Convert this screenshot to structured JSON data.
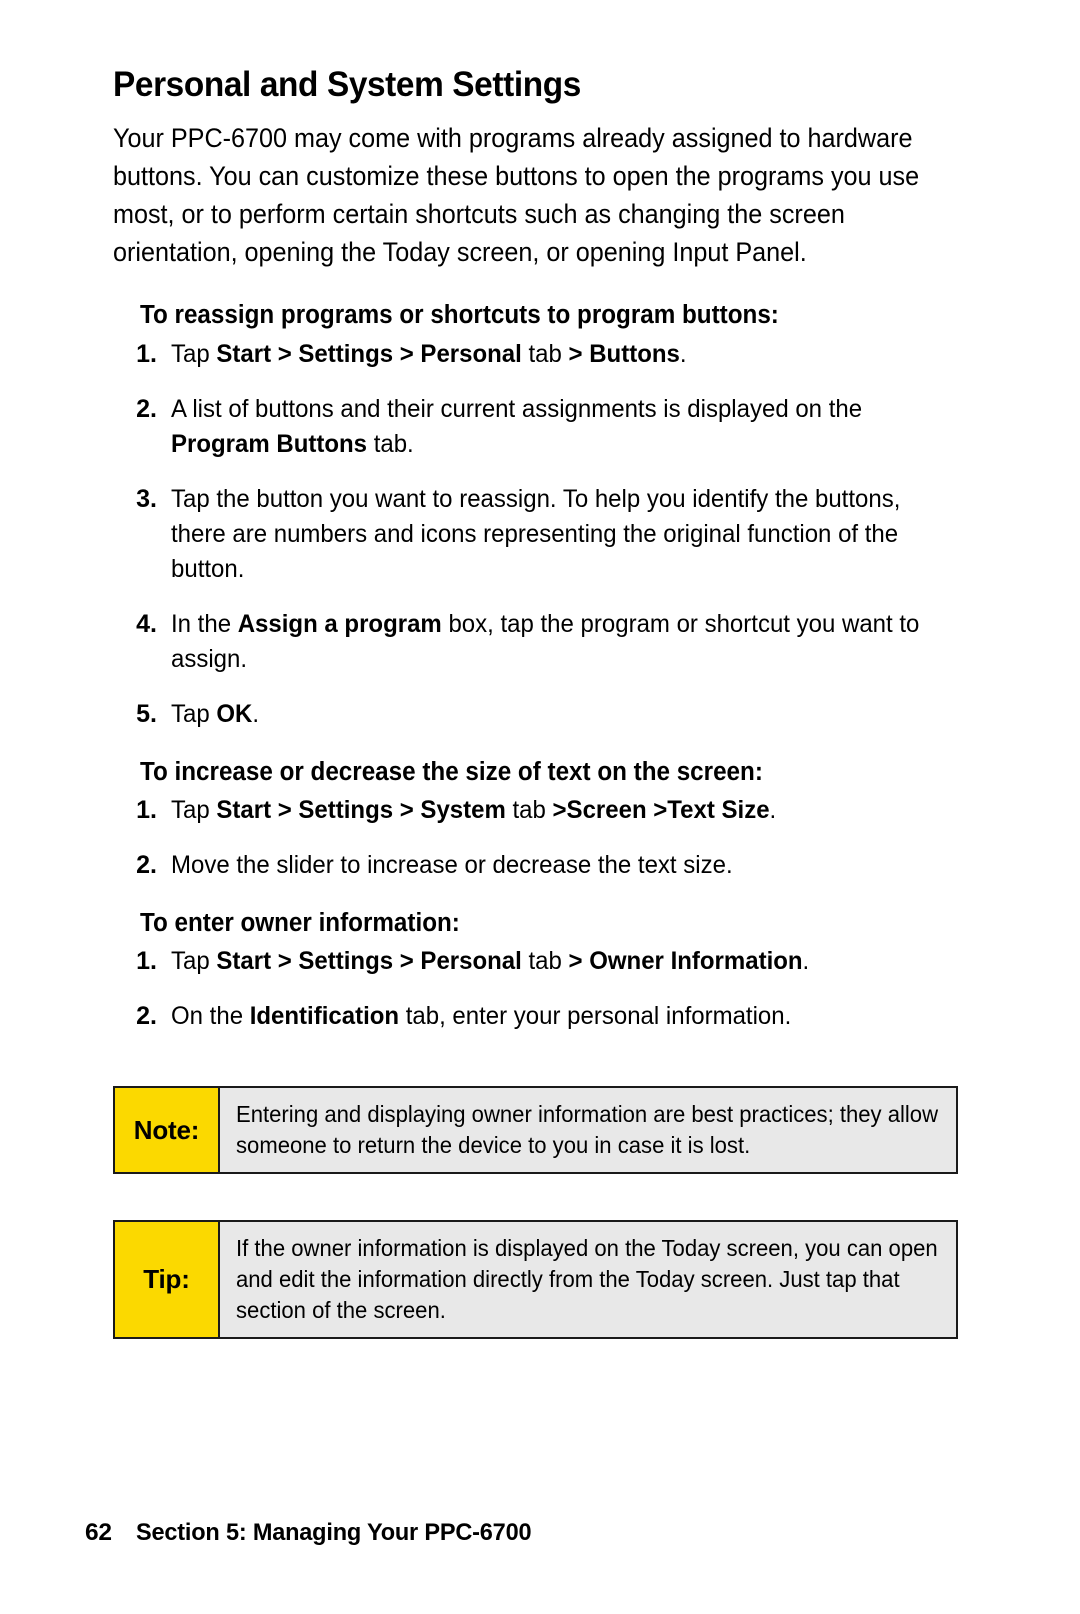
{
  "page": {
    "title": "Personal and System Settings",
    "intro": "Your PPC-6700 may come with programs already assigned to hardware buttons. You can customize these buttons to open the programs you use most, or to perform certain shortcuts such as changing the screen orientation, opening the Today screen, or opening Input Panel."
  },
  "sections": [
    {
      "heading": "To reassign programs or shortcuts to program buttons:",
      "steps": [
        {
          "number": "1.",
          "html": "Tap <b>Start &gt; Settings &gt; Personal</b> tab <b>&gt; Buttons</b>."
        },
        {
          "number": "2.",
          "html": "A list of buttons and their current assignments is displayed on the <b>Program Buttons</b> tab."
        },
        {
          "number": "3.",
          "html": "Tap the button you want to reassign. To help you identify the buttons, there are numbers and icons representing the original function of the button."
        },
        {
          "number": "4.",
          "html": "In the <b>Assign a program</b> box, tap the program or shortcut you want to assign."
        },
        {
          "number": "5.",
          "html": "Tap <b>OK</b>."
        }
      ]
    },
    {
      "heading": "To increase or decrease the size of text on the screen:",
      "steps": [
        {
          "number": "1.",
          "html": "Tap <b>Start &gt; Settings &gt; System</b> tab <b>&gt;Screen &gt;Text Size</b>."
        },
        {
          "number": "2.",
          "html": "Move the slider to increase or decrease the text size."
        }
      ]
    },
    {
      "heading": "To enter owner information:",
      "steps": [
        {
          "number": "1.",
          "html": "Tap <b>Start &gt; Settings &gt; Personal</b> tab <b>&gt; Owner Information</b>."
        },
        {
          "number": "2.",
          "html": "On the <b>Identification</b> tab, enter your personal information."
        }
      ]
    }
  ],
  "callouts": [
    {
      "label": "Note:",
      "text": "Entering and displaying owner information are best practices; they allow someone to return the device to you in case it is lost."
    },
    {
      "label": "Tip:",
      "text": "If the owner information is displayed on the Today screen, you can open and edit the information directly from the Today screen. Just tap that section of the screen."
    }
  ],
  "footer": {
    "page_number": "62",
    "text": "Section 5: Managing Your PPC-6700"
  },
  "colors": {
    "callout_label_background": "#fbd900",
    "callout_body_background": "#e8e8e8",
    "border": "#1a1a1a",
    "text": "#000000",
    "page_background": "#ffffff"
  }
}
